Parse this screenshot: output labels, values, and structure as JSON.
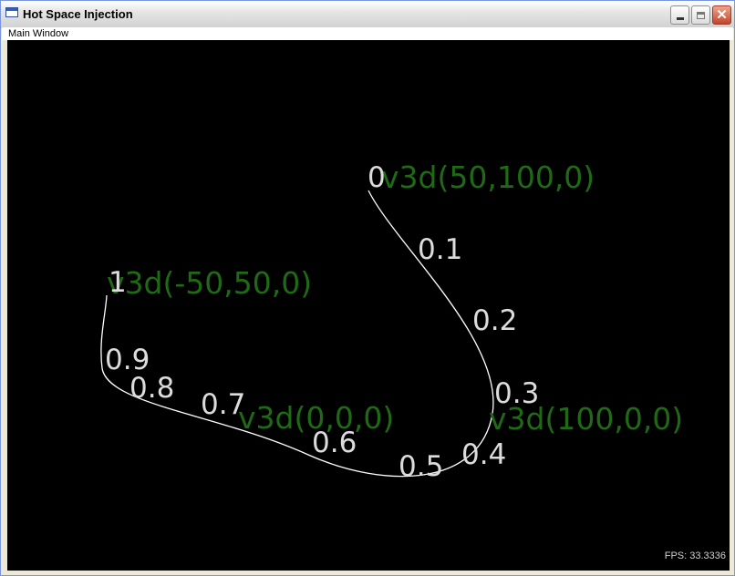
{
  "window": {
    "title": "Hot Space Injection",
    "minimize_icon": "minimize-icon",
    "maximize_icon": "maximize-icon",
    "close_icon": "close-icon"
  },
  "menubar": {
    "main_window": "Main Window"
  },
  "scene": {
    "curve_color": "#ffffff",
    "param_label_color": "#dcdcdc",
    "control_label_color": "#1f6a14",
    "control_points": [
      {
        "label": "v3d(50,100,0)"
      },
      {
        "label": "v3d(-50,50,0)"
      },
      {
        "label": "v3d(0,0,0)"
      },
      {
        "label": "v3d(100,0,0)"
      }
    ],
    "param_labels": [
      "0",
      "0.1",
      "0.2",
      "0.3",
      "0.4",
      "0.5",
      "0.6",
      "0.7",
      "0.8",
      "0.9",
      "1"
    ]
  },
  "status": {
    "fps": "FPS: 33.3336"
  }
}
